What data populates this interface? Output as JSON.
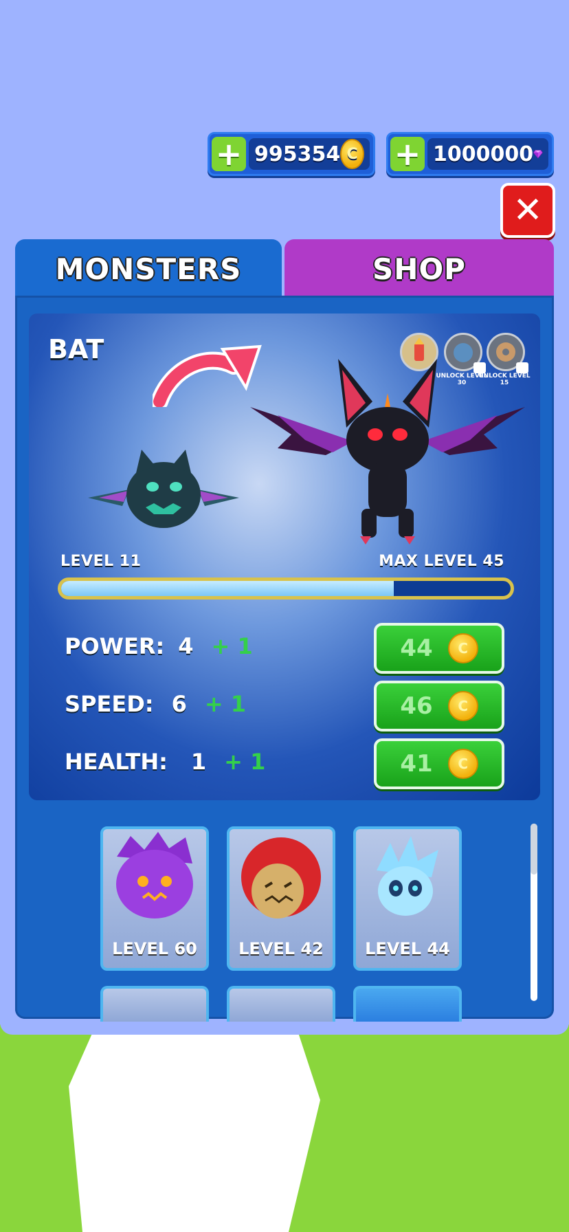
{
  "currencies": {
    "coins": {
      "value": "995354",
      "add_label": "+",
      "icon": "coin-icon",
      "coin_glyph": "C"
    },
    "gems": {
      "value": "1000000",
      "add_label": "+",
      "icon": "gem-icon"
    }
  },
  "close_label": "✕",
  "tabs": {
    "monsters": "MONSTERS",
    "shop": "SHOP"
  },
  "detail": {
    "name": "BAT",
    "level_label": "LEVEL 11",
    "max_level_label": "MAX LEVEL 45",
    "progress": 0.74,
    "skins": [
      {
        "icon": "pencil-creature-icon",
        "locked": false,
        "label": ""
      },
      {
        "icon": "blue-monster-icon",
        "locked": true,
        "label": "UNLOCK LEVEL 30"
      },
      {
        "icon": "donut-icon",
        "locked": true,
        "label": "UNLOCK LEVEL 15"
      }
    ],
    "stats": [
      {
        "label": "POWER:",
        "value": "4",
        "bonus": "+ 1",
        "cost": "44"
      },
      {
        "label": "SPEED:",
        "value": "6",
        "bonus": "+ 1",
        "cost": "46"
      },
      {
        "label": "HEALTH:",
        "value": "1",
        "bonus": "+ 1",
        "cost": "41"
      }
    ]
  },
  "monster_cards": [
    {
      "label": "LEVEL 60",
      "icon": "purple-spiky-monster-icon"
    },
    {
      "label": "LEVEL 42",
      "icon": "red-hooded-monster-icon"
    },
    {
      "label": "LEVEL 44",
      "icon": "ice-spirit-monster-icon"
    }
  ],
  "colors": {
    "accent_blue": "#1a6bd0",
    "shop_purple": "#b03ac8",
    "buy_green": "#19a21a",
    "close_red": "#e01c1c"
  }
}
